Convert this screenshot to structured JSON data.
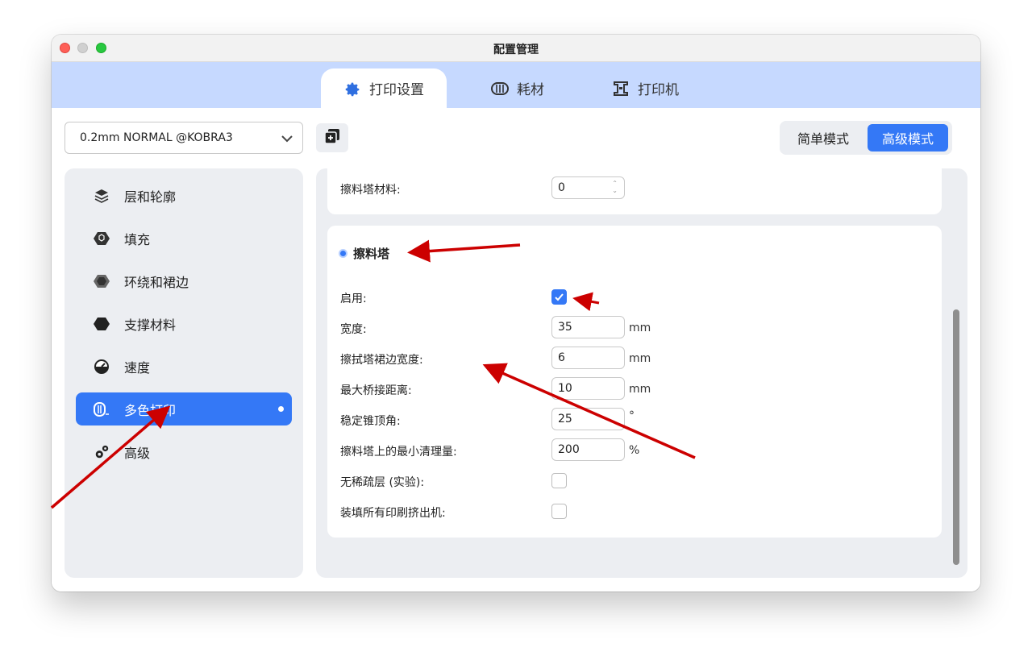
{
  "window": {
    "title": "配置管理"
  },
  "tabs": [
    {
      "label": "打印设置",
      "icon": "gear-icon",
      "active": true
    },
    {
      "label": "耗材",
      "icon": "filament-spool-icon",
      "active": false
    },
    {
      "label": "打印机",
      "icon": "printer-icon",
      "active": false
    }
  ],
  "toolbar": {
    "preset": "0.2mm NORMAL @KOBRA3",
    "modes": {
      "simple": "简单模式",
      "advanced": "高级模式",
      "active": "advanced"
    }
  },
  "sidebar": {
    "items": [
      {
        "label": "层和轮廓",
        "icon": "layers-icon"
      },
      {
        "label": "填充",
        "icon": "infill-icon"
      },
      {
        "label": "环绕和裙边",
        "icon": "skirt-icon"
      },
      {
        "label": "支撑材料",
        "icon": "support-icon"
      },
      {
        "label": "速度",
        "icon": "speed-icon"
      },
      {
        "label": "多色打印",
        "icon": "multicolor-icon",
        "active": true
      },
      {
        "label": "高级",
        "icon": "advanced-gears-icon"
      }
    ]
  },
  "main": {
    "top_card": {
      "label": "擦料塔材料:",
      "value": "0"
    },
    "wipe_tower": {
      "title": "擦料塔",
      "rows": [
        {
          "label": "启用:",
          "type": "checkbox",
          "checked": true
        },
        {
          "label": "宽度:",
          "type": "number",
          "value": "35",
          "unit": "mm"
        },
        {
          "label": "擦拭塔裙边宽度:",
          "type": "number",
          "value": "6",
          "unit": "mm"
        },
        {
          "label": "最大桥接距离:",
          "type": "number",
          "value": "10",
          "unit": "mm"
        },
        {
          "label": "稳定锥顶角:",
          "type": "number",
          "value": "25",
          "unit": "°"
        },
        {
          "label": "擦料塔上的最小清理量:",
          "type": "number",
          "value": "200",
          "unit": "%"
        },
        {
          "label": "无稀疏层 (实验):",
          "type": "checkbox",
          "checked": false
        },
        {
          "label": "装填所有印刷挤出机:",
          "type": "checkbox",
          "checked": false
        }
      ]
    }
  },
  "colors": {
    "accent": "#3478f6",
    "tabbar": "#c6d9ff",
    "panel": "#eceef2",
    "annotation_arrow": "#cc0000"
  }
}
